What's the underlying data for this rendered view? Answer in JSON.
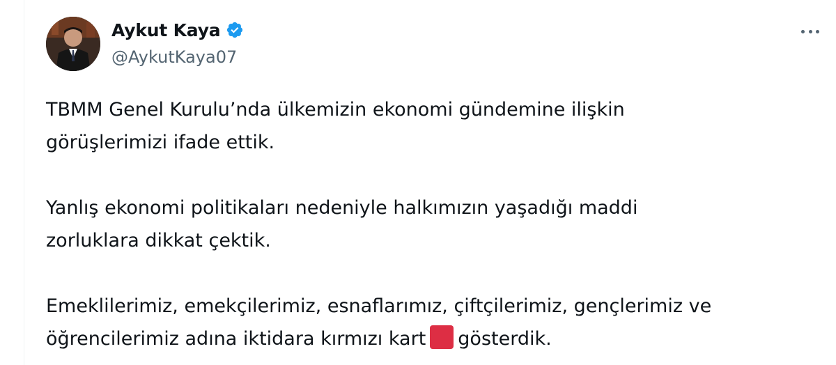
{
  "author": {
    "display_name": "Aykut Kaya",
    "handle": "@AykutKaya07",
    "verified": true,
    "verified_color": "#1d9bf0"
  },
  "menu": {
    "icon": "more-horizontal-icon"
  },
  "tweet": {
    "p1_line1": "TBMM Genel Kurulu’nda ülkemizin ekonomi gündemine ilişkin",
    "p1_line2": "görüşlerimizi ifade ettik.",
    "p2_line1": "Yanlış ekonomi politikaları nedeniyle halkımızın yaşadığı maddi",
    "p2_line2": "zorluklara dikkat çektik.",
    "p3_line1": "Emeklilerimiz, emekçilerimiz, esnaflarımız, çiftçilerimiz, gençlerimiz ve",
    "p3_line2_before": "öğrencilerimiz adına iktidara kırmızı kart",
    "p3_line2_after": "gösterdik.",
    "emoji": "red-card-icon",
    "emoji_color": "#dd2e44"
  },
  "colors": {
    "text": "#0f1419",
    "secondary": "#536471"
  }
}
